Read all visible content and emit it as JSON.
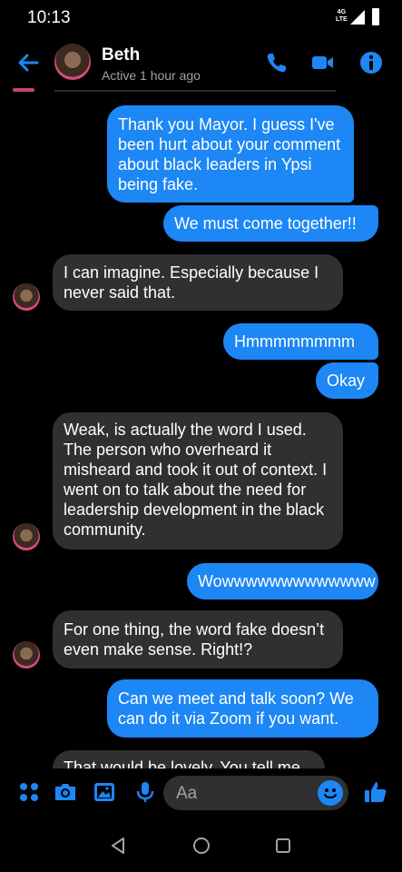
{
  "status_bar": {
    "time": "10:13",
    "network": "4G",
    "network_sub": "LTE"
  },
  "header": {
    "contact_name": "Beth",
    "contact_status": "Active 1 hour ago"
  },
  "messages": [
    {
      "from": "me",
      "text": "Thank you Mayor. I guess I've been hurt about your comment about black leaders in Ypsi being fake."
    },
    {
      "from": "me",
      "text": "We must come together!!"
    },
    {
      "from": "them",
      "text": "I can imagine. Especially because I never said that."
    },
    {
      "from": "me",
      "text": "Hmmmmmmmm"
    },
    {
      "from": "me",
      "text": "Okay"
    },
    {
      "from": "them",
      "text": "Weak, is actually the word I used. The person who overheard it misheard and took it out of context. I went on to talk about the need for leadership development in the black community."
    },
    {
      "from": "me",
      "text": "Wowwwwwwwwwwwww"
    },
    {
      "from": "them",
      "text": "For one thing, the word fake doesn’t even make sense. Right!?"
    },
    {
      "from": "me",
      "text": "Can we meet and talk soon? We can do it via Zoom if you want."
    },
    {
      "from": "them",
      "text": "That would be lovely. You tell me"
    }
  ],
  "composer": {
    "placeholder": "Aa"
  },
  "colors": {
    "sent_bubble": "#1c87f5",
    "received_bubble": "#303030",
    "accent": "#1c87f5",
    "background": "#000000"
  },
  "icons": [
    "back-arrow-icon",
    "phone-icon",
    "video-icon",
    "info-icon",
    "more-icon",
    "camera-icon",
    "gallery-icon",
    "mic-icon",
    "emoji-icon",
    "like-icon",
    "nav-back-icon",
    "nav-home-icon",
    "nav-recent-icon"
  ]
}
